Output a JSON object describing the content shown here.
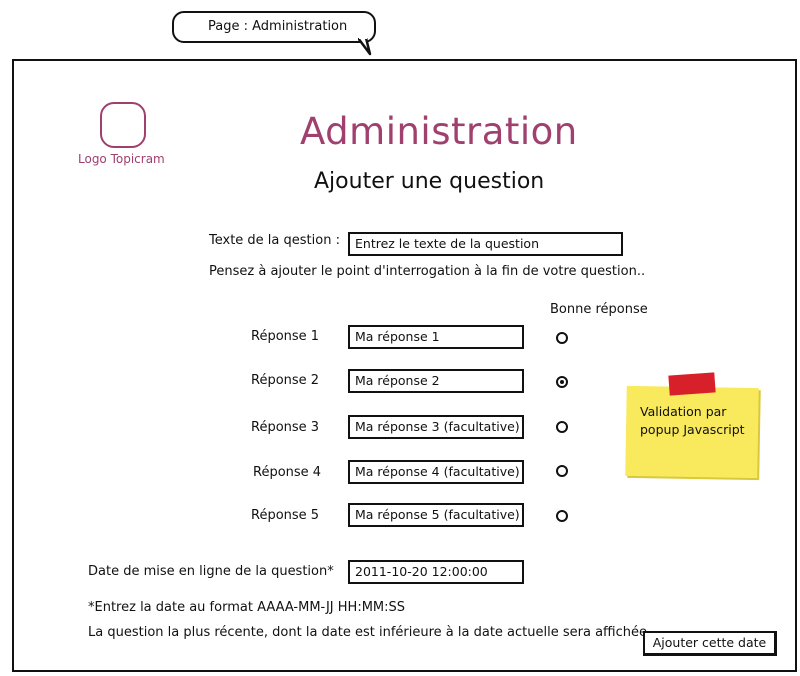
{
  "page_bubble": {
    "text": "Page : Administration"
  },
  "logo": {
    "label": "Logo Topicram"
  },
  "header": {
    "title": "Administration",
    "subtitle": "Ajouter une question"
  },
  "question": {
    "label": "Texte de la qestion :",
    "placeholder": "Entrez le texte de la question",
    "hint": "Pensez à ajouter le point d'interrogation à la fin de votre question.."
  },
  "answers_header": "Bonne réponse",
  "answers": [
    {
      "label": "Réponse 1",
      "value": "Ma réponse 1",
      "correct": false
    },
    {
      "label": "Réponse 2",
      "value": "Ma réponse 2",
      "correct": true
    },
    {
      "label": "Réponse 3",
      "value": "Ma réponse 3 (facultative)",
      "correct": false
    },
    {
      "label": "Réponse 4",
      "value": "Ma réponse 4 (facultative)",
      "correct": false
    },
    {
      "label": "Réponse 5",
      "value": "Ma réponse 5 (facultative)",
      "correct": false
    }
  ],
  "note": {
    "line1": "Validation par",
    "line2": "popup Javascript",
    "color": "#f9e95c"
  },
  "date": {
    "label": "Date de mise en ligne de la question*",
    "value": "2011-10-20 12:00:00",
    "format_hint": "*Entrez la date au format AAAA-MM-JJ HH:MM:SS",
    "info": "La question la plus récente, dont la date est inférieure à la date actuelle sera affichée."
  },
  "submit": {
    "label": "Ajouter cette date"
  },
  "colors": {
    "accent": "#a0406e",
    "tape": "#d8202a"
  }
}
